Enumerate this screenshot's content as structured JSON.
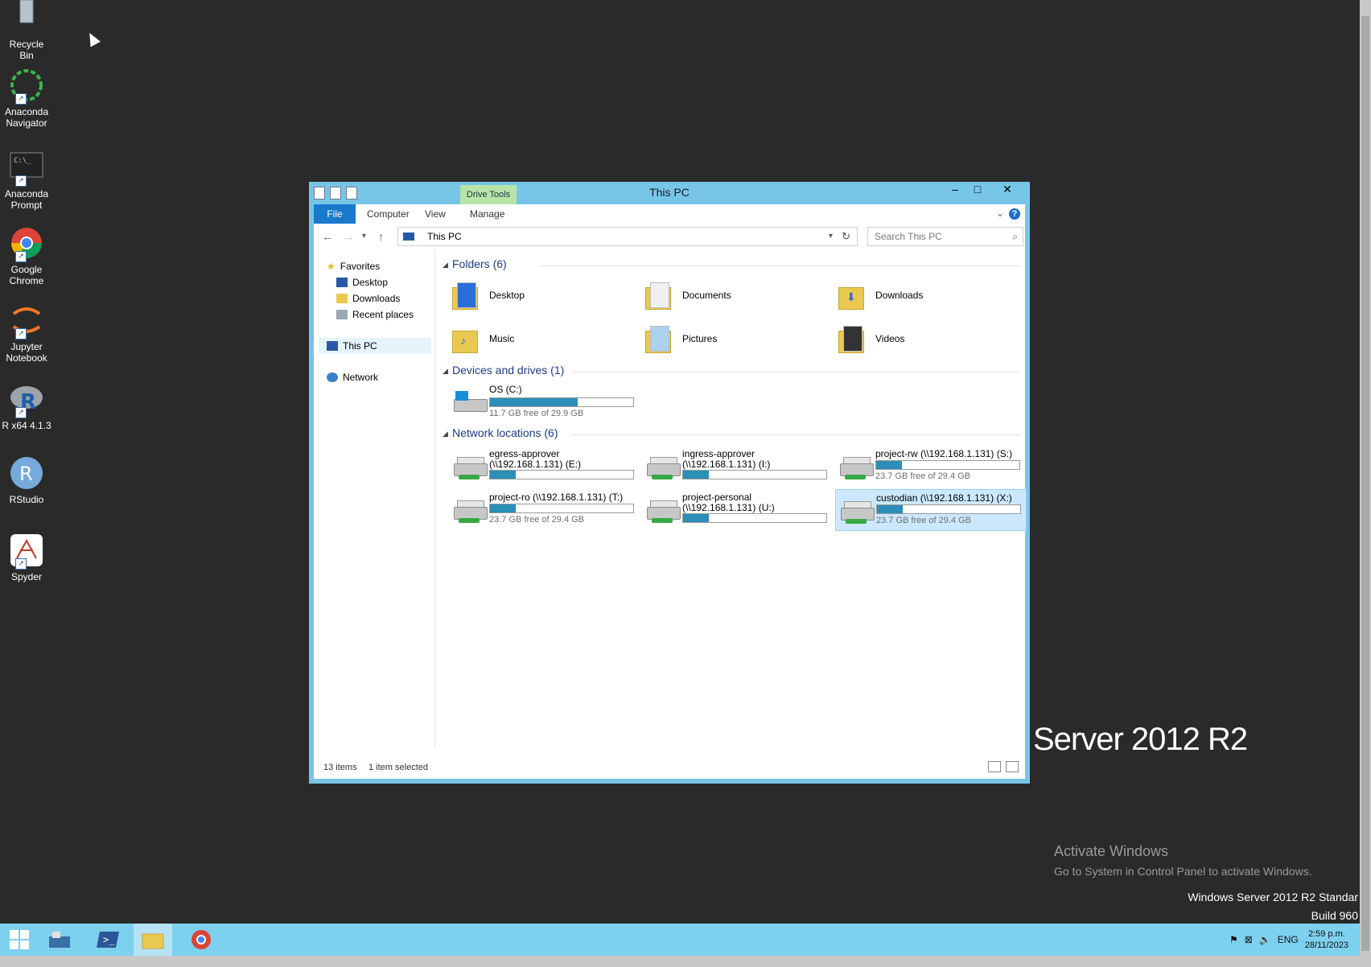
{
  "desktop": {
    "icons": [
      {
        "label": "Recycle Bin"
      },
      {
        "label": "Anaconda Navigator"
      },
      {
        "label": "Anaconda Prompt"
      },
      {
        "label": "Google Chrome"
      },
      {
        "label": "Jupyter Notebook"
      },
      {
        "label": "R x64 4.1.3"
      },
      {
        "label": "RStudio"
      },
      {
        "label": "Spyder"
      }
    ],
    "watermark": {
      "brand": "Server 2012 R2",
      "activate_title": "Activate Windows",
      "activate_sub": "Go to System in Control Panel to activate Windows.",
      "edition": "Windows Server 2012 R2 Standar",
      "build": "Build 960"
    }
  },
  "window": {
    "title": "This PC",
    "context_tab": "Drive Tools",
    "ribbon_tabs": [
      "File",
      "Computer",
      "View",
      "Manage"
    ],
    "address_path": "This PC",
    "search_placeholder": "Search This PC",
    "nav": {
      "favorites": "Favorites",
      "fav_items": [
        "Desktop",
        "Downloads",
        "Recent places"
      ],
      "this_pc": "This PC",
      "network": "Network"
    },
    "groups": {
      "folders": "Folders (6)",
      "devices": "Devices and drives (1)",
      "network": "Network locations (6)"
    },
    "folders": [
      "Desktop",
      "Documents",
      "Downloads",
      "Music",
      "Pictures",
      "Videos"
    ],
    "local_drive": {
      "name": "OS (C:)",
      "free": "11.7 GB free of 29.9 GB",
      "used_fraction": 0.61
    },
    "network_drives": [
      {
        "name": "egress-approver (\\\\192.168.1.131) (E:)",
        "free": "",
        "used_fraction": 0.18
      },
      {
        "name": "ingress-approver (\\\\192.168.1.131) (I:)",
        "free": "",
        "used_fraction": 0.18
      },
      {
        "name": "project-rw (\\\\192.168.1.131) (S:)",
        "free": "23.7 GB free of 29.4 GB",
        "used_fraction": 0.18
      },
      {
        "name": "project-ro (\\\\192.168.1.131) (T:)",
        "free": "23.7 GB free of 29.4 GB",
        "used_fraction": 0.18
      },
      {
        "name": "project-personal (\\\\192.168.1.131) (U:)",
        "free": "",
        "used_fraction": 0.18
      },
      {
        "name": "custodian (\\\\192.168.1.131) (X:)",
        "free": "23.7 GB free of 29.4 GB",
        "used_fraction": 0.18
      }
    ],
    "status": {
      "items": "13 items",
      "selected": "1 item selected"
    }
  },
  "taskbar": {
    "lang": "ENG",
    "time": "2:59 p.m.",
    "date": "28/11/2023"
  },
  "colors": {
    "accent": "#1979ca",
    "taskbar": "#7ed0ef",
    "drive_bar": "#2b8fb8"
  }
}
